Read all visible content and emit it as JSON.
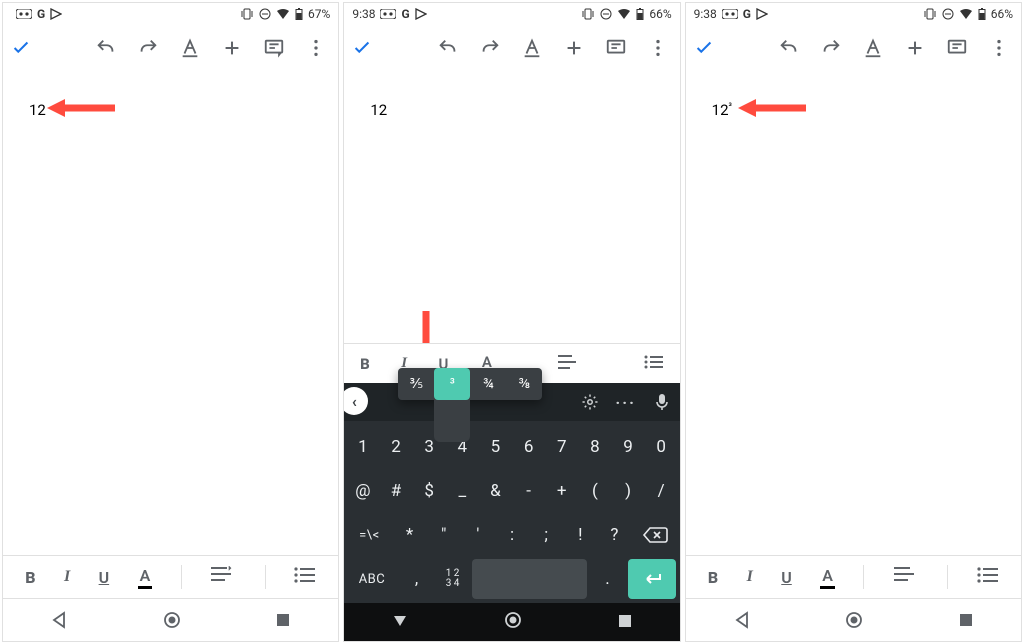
{
  "phones": [
    {
      "time": "",
      "battery": "67%",
      "doc": {
        "text": "12",
        "super": ""
      }
    },
    {
      "time": "9:38",
      "battery": "66%",
      "doc": {
        "text": "12",
        "super": ""
      }
    },
    {
      "time": "9:38",
      "battery": "66%",
      "doc": {
        "text": "12",
        "super": "³"
      }
    }
  ],
  "fmt": {
    "bold": "B",
    "italic": "I",
    "underline": "U",
    "color": "A"
  },
  "popup": {
    "opt1": "⅗",
    "sel": "³",
    "opt3": "¾",
    "opt4": "⅜"
  },
  "kb": {
    "row1": [
      "1",
      "2",
      "3",
      "4",
      "5",
      "6",
      "7",
      "8",
      "9",
      "0"
    ],
    "row2": [
      "@",
      "#",
      "$",
      "_",
      "&",
      "-",
      "+",
      "(",
      ")",
      "/"
    ],
    "row3_lead": "=\\<",
    "row3": [
      "*",
      "\"",
      "'",
      ":",
      ";",
      "!",
      "?"
    ],
    "abc": "ABC",
    "numstack_top": "1 2",
    "numstack_bot": "3 4",
    "comma": ",",
    "period": "."
  }
}
